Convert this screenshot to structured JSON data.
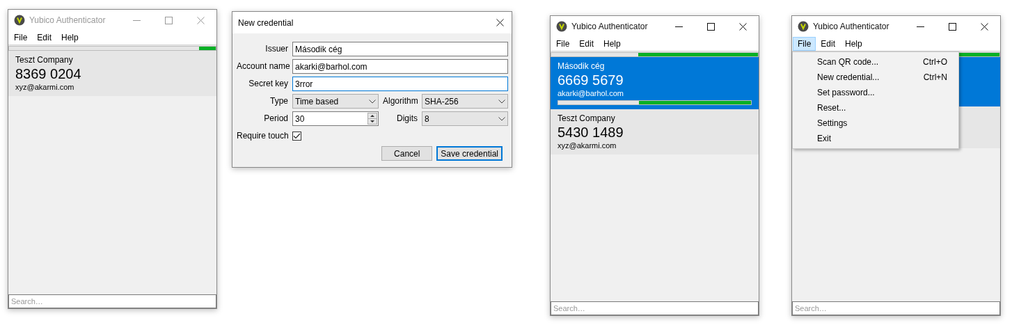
{
  "windows": [
    {
      "kind": "main",
      "title": "Yubico Authenticator",
      "active": false,
      "menu": [
        {
          "label": "File",
          "selected": false
        },
        {
          "label": "Edit",
          "selected": false
        },
        {
          "label": "Help",
          "selected": false
        }
      ],
      "timer": {
        "level": 0.08
      },
      "credentials": [
        {
          "issuer": "Teszt Company",
          "code": "8369 0204",
          "account": "xyz@akarmi.com",
          "selected": false
        }
      ],
      "search": {
        "placeholder": "Search…"
      }
    },
    {
      "kind": "dialog",
      "title": "New credential",
      "rows": [
        [
          {
            "kind": "text",
            "label": "Issuer",
            "value": "Második cég",
            "focused": false
          }
        ],
        [
          {
            "kind": "text",
            "label": "Account name",
            "value": "akarki@barhol.com",
            "focused": false
          }
        ],
        [
          {
            "kind": "text",
            "label": "Secret key",
            "value": "3rror",
            "focused": true
          }
        ],
        [
          {
            "kind": "select",
            "label": "Type",
            "value": "Time based"
          },
          {
            "kind": "select",
            "label": "Algorithm",
            "value": "SHA-256"
          }
        ],
        [
          {
            "kind": "spin",
            "label": "Period",
            "value": "30"
          },
          {
            "kind": "select",
            "label": "Digits",
            "value": "8"
          }
        ],
        [
          {
            "kind": "checkbox",
            "label": "Require touch",
            "checked": true
          }
        ]
      ],
      "buttons": [
        {
          "label": "Cancel",
          "default": false
        },
        {
          "label": "Save credential",
          "default": true
        }
      ]
    },
    {
      "kind": "main",
      "title": "Yubico Authenticator",
      "active": true,
      "menu": [
        {
          "label": "File",
          "selected": false
        },
        {
          "label": "Edit",
          "selected": false
        },
        {
          "label": "Help",
          "selected": false
        }
      ],
      "timer": {
        "level": 0.58
      },
      "credentials": [
        {
          "issuer": "Második cég",
          "code": "6669 5679",
          "account": "akarki@barhol.com",
          "selected": true,
          "level": 0.58
        },
        {
          "issuer": "Teszt Company",
          "code": "5430 1489",
          "account": "xyz@akarmi.com",
          "selected": false
        }
      ],
      "search": {
        "placeholder": "Search…"
      }
    },
    {
      "kind": "main",
      "title": "Yubico Authenticator",
      "active": true,
      "menu": [
        {
          "label": "File",
          "selected": true
        },
        {
          "label": "Edit",
          "selected": false
        },
        {
          "label": "Help",
          "selected": false
        }
      ],
      "timer": {
        "level": 0.58
      },
      "credentials": [
        {
          "selected": true
        },
        {
          "selected": false
        }
      ],
      "dropdown": [
        {
          "label": "Scan QR code...",
          "shortcut": "Ctrl+O"
        },
        {
          "label": "New credential...",
          "shortcut": "Ctrl+N"
        },
        {
          "label": "Set password..."
        },
        {
          "label": "Reset..."
        },
        {
          "label": "Settings"
        },
        {
          "label": "Exit"
        }
      ],
      "search": {
        "placeholder": "Search…"
      }
    }
  ]
}
